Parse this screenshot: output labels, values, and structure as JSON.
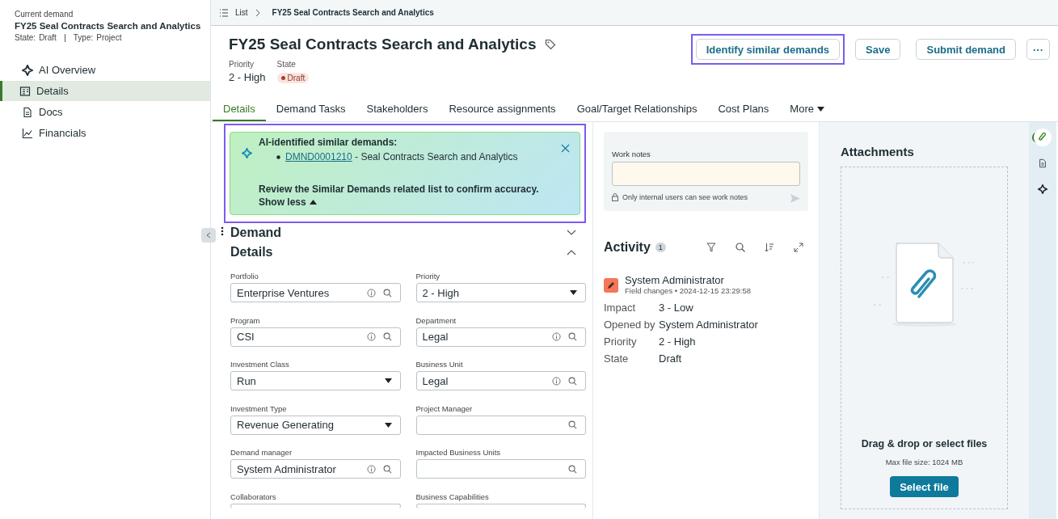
{
  "sidebar": {
    "caption": "Current demand",
    "title": "FY25 Seal Contracts Search and Analytics",
    "state_label": "State:",
    "state": "Draft",
    "type_label": "Type:",
    "type": "Project",
    "items": [
      {
        "label": "AI Overview",
        "selected": false
      },
      {
        "label": "Details",
        "selected": true
      },
      {
        "label": "Docs",
        "selected": false
      },
      {
        "label": "Financials",
        "selected": false
      }
    ]
  },
  "breadcrumb": {
    "list": "List",
    "current": "FY25 Seal Contracts Search and Analytics"
  },
  "header": {
    "title": "FY25 Seal Contracts Search and Analytics",
    "priority_label": "Priority",
    "priority": "2 - High",
    "state_label": "State",
    "state": "Draft",
    "buttons": [
      {
        "label": "Identify similar demands",
        "highlighted": true
      },
      {
        "label": "Save",
        "highlighted": false
      },
      {
        "label": "Submit demand",
        "highlighted": false
      }
    ],
    "more": "···"
  },
  "tabs": [
    {
      "label": "Details",
      "selected": true
    },
    {
      "label": "Demand Tasks",
      "selected": false
    },
    {
      "label": "Stakeholders",
      "selected": false
    },
    {
      "label": "Resource assignments",
      "selected": false
    },
    {
      "label": "Goal/Target Relationships",
      "selected": false
    },
    {
      "label": "Cost Plans",
      "selected": false
    },
    {
      "label": "More",
      "selected": false
    }
  ],
  "banner": {
    "highlighted": true,
    "title": "AI-identified similar demands:",
    "link": "DMND0001210",
    "link_text": " - Seal Contracts Search and Analytics",
    "review": "Review the Similar Demands related list to confirm accuracy.",
    "toggle": "Show less"
  },
  "section": {
    "title1": "Demand",
    "title2": "Details"
  },
  "fields": [
    {
      "label": "Portfolio",
      "value": "Enterprise Ventures",
      "kind": "lookup"
    },
    {
      "label": "Priority",
      "value": "2 - High",
      "kind": "select"
    },
    {
      "label": "Program",
      "value": "CSI",
      "kind": "lookup"
    },
    {
      "label": "Department",
      "value": "Legal",
      "kind": "lookup"
    },
    {
      "label": "Investment Class",
      "value": "Run",
      "kind": "select"
    },
    {
      "label": "Business Unit",
      "value": "Legal",
      "kind": "lookup"
    },
    {
      "label": "Investment Type",
      "value": "Revenue Generating",
      "kind": "select"
    },
    {
      "label": "Project Manager",
      "kind": "reference"
    },
    {
      "label": "Demand manager",
      "value": "System Administrator",
      "kind": "lookup"
    },
    {
      "label": "Impacted Business Units",
      "kind": "reference"
    },
    {
      "label": "Collaborators",
      "kind": "cut"
    },
    {
      "label": "Business Capabilities",
      "kind": "cut"
    }
  ],
  "work_notes": {
    "label": "Work notes",
    "hint": "Only internal users can see work notes"
  },
  "activity": {
    "title": "Activity",
    "count": "1",
    "author": "System Administrator",
    "meta": "Field changes • 2024-12-15 23:29:58",
    "changes": [
      {
        "field": "Impact",
        "value": "3 - Low"
      },
      {
        "field": "Opened by",
        "value": "System Administrator"
      },
      {
        "field": "Priority",
        "value": "2 - High"
      },
      {
        "field": "State",
        "value": "Draft"
      }
    ]
  },
  "attachments": {
    "title": "Attachments",
    "drop": "Drag & drop or select files",
    "max": "Max file size: 1024 MB",
    "button": "Select file"
  },
  "rail": [
    {
      "selected": true
    },
    {
      "selected": false
    },
    {
      "selected": false
    }
  ]
}
